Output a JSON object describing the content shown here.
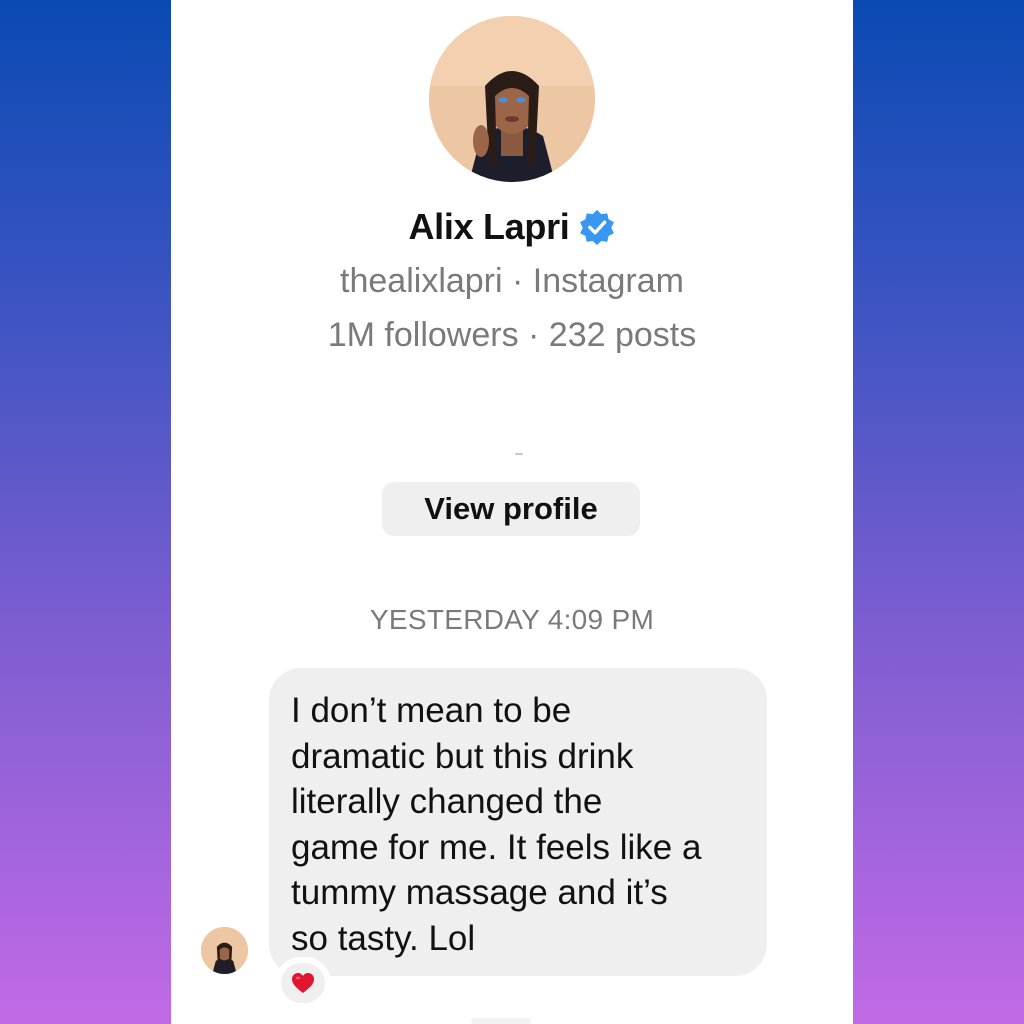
{
  "profile": {
    "name": "Alix Lapri",
    "verified_icon": "verified-badge-icon",
    "handle_line": "thealixlapri · Instagram",
    "stats_line": "1M followers · 232 posts",
    "view_profile_label": "View profile"
  },
  "thread": {
    "timestamp": "YESTERDAY 4:09 PM",
    "message": {
      "text": "I don’t mean to be\ndramatic but this drink\nliterally changed the\ngame for me. It feels like a\ntummy massage and it’s\nso tasty. Lol",
      "reaction_icon": "heart-icon"
    }
  },
  "colors": {
    "verified": "#3897f0",
    "bubble": "#efefef",
    "secondary_text": "#7a7a7a",
    "heart": "#e0152f",
    "background_top": "#0a4ab3",
    "background_bottom": "#c26ae6"
  }
}
